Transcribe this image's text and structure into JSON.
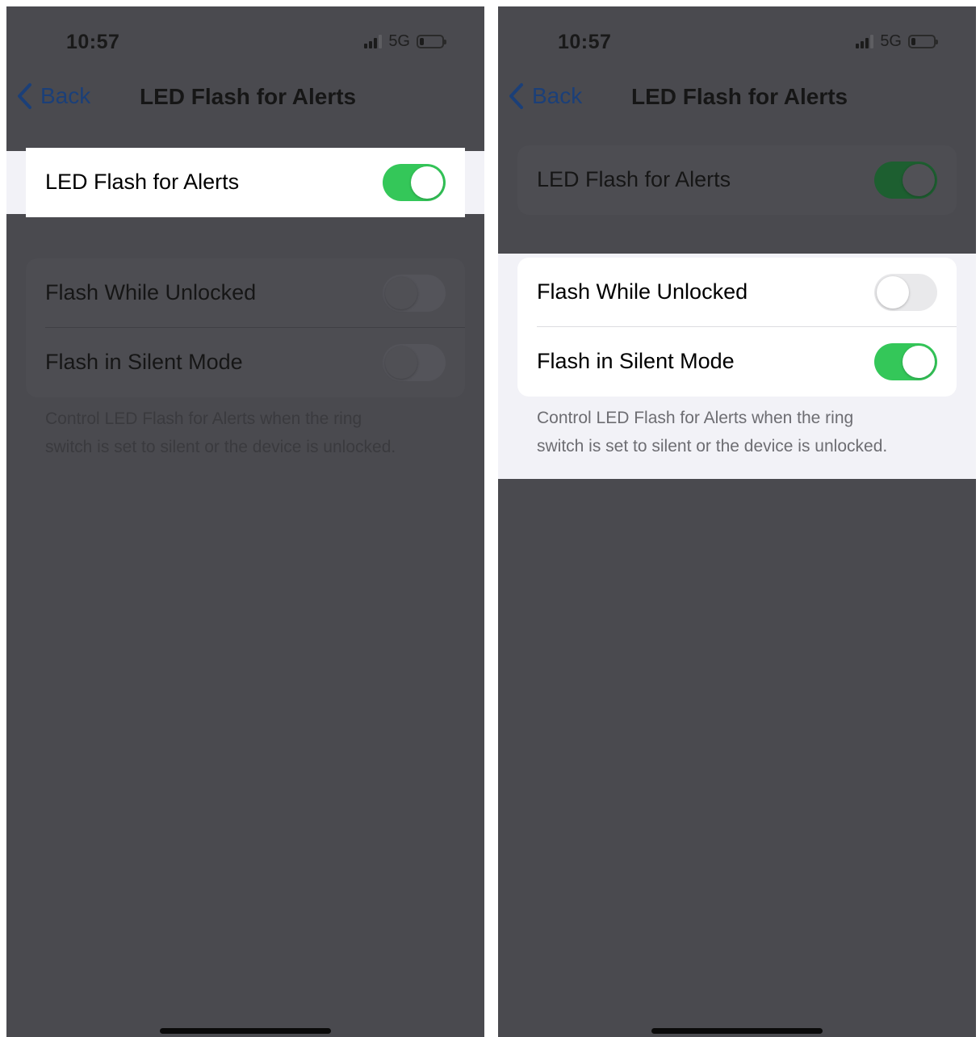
{
  "colors": {
    "toggle_on": "#34c759",
    "dim_overlay": "#4a4a4f",
    "highlight_bg": "#f2f2f7",
    "link_blue": "#007aff"
  },
  "screens": [
    {
      "status": {
        "time": "10:57",
        "network": "5G",
        "battery_level": 0.2
      },
      "nav": {
        "back_label": "Back",
        "title": "LED Flash for Alerts",
        "back_icon": "chevron-left-icon"
      },
      "main_toggle": {
        "label": "LED Flash for Alerts",
        "on": true
      },
      "options": [
        {
          "label": "Flash While Unlocked",
          "on": false
        },
        {
          "label": "Flash in Silent Mode",
          "on": false
        }
      ],
      "footer_line1": "Control LED Flash for Alerts when the ring",
      "footer_line2": "switch is set to silent or the device is unlocked.",
      "highlighted_section": "main_toggle"
    },
    {
      "status": {
        "time": "10:57",
        "network": "5G",
        "battery_level": 0.2
      },
      "nav": {
        "back_label": "Back",
        "title": "LED Flash for Alerts",
        "back_icon": "chevron-left-icon"
      },
      "main_toggle": {
        "label": "LED Flash for Alerts",
        "on": true
      },
      "options": [
        {
          "label": "Flash While Unlocked",
          "on": false
        },
        {
          "label": "Flash in Silent Mode",
          "on": true
        }
      ],
      "footer_line1": "Control LED Flash for Alerts when the ring",
      "footer_line2": "switch is set to silent or the device is unlocked.",
      "highlighted_section": "options"
    }
  ]
}
